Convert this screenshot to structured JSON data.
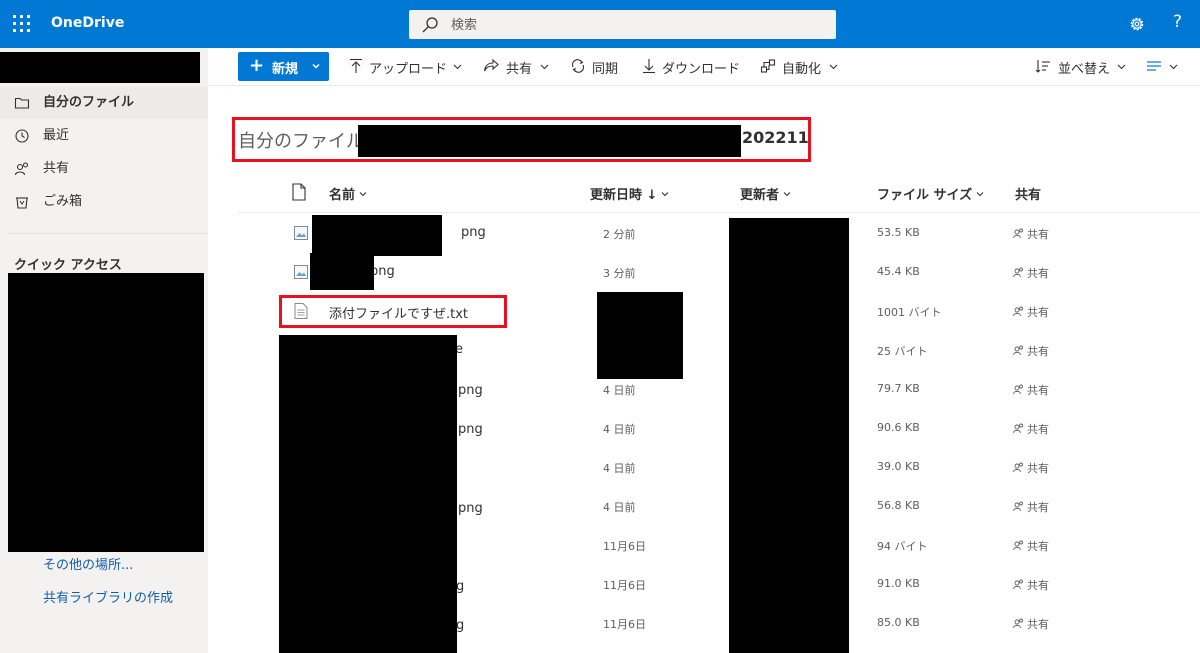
{
  "app": {
    "name": "OneDrive"
  },
  "search": {
    "placeholder": "検索"
  },
  "header": {
    "help_label": "?"
  },
  "nav": {
    "items": [
      {
        "label": "自分のファイル",
        "icon": "folder-icon"
      },
      {
        "label": "最近",
        "icon": "recent-icon"
      },
      {
        "label": "共有",
        "icon": "shared-icon"
      },
      {
        "label": "ごみ箱",
        "icon": "recycle-bin-icon"
      }
    ],
    "quick_access_title": "クイック アクセス",
    "links": [
      "その他の場所...",
      "共有ライブラリの作成"
    ]
  },
  "toolbar": {
    "new_label": "新規",
    "upload_label": "アップロード",
    "share_label": "共有",
    "sync_label": "同期",
    "download_label": "ダウンロード",
    "automate_label": "自動化",
    "sort_label": "並べ替え"
  },
  "breadcrumb": {
    "title": "自分のファイル",
    "suffix": "202211"
  },
  "table": {
    "headers": {
      "name": "名前",
      "modified": "更新日時 ↓",
      "modified_by": "更新者",
      "size": "ファイル サイズ",
      "sharing": "共有"
    },
    "rows": [
      {
        "name": "png",
        "modified": "2 分前",
        "size": "53.5 KB",
        "sharing": "共有",
        "type": "image"
      },
      {
        "name": "png",
        "modified": "3 分前",
        "size": "45.4 KB",
        "sharing": "共有",
        "type": "image"
      },
      {
        "name": "添付ファイルですぜ.txt",
        "modified": "",
        "size": "1001 バイト",
        "sharing": "共有",
        "type": "text"
      },
      {
        "name": "e",
        "modified": "",
        "size": "25 バイト",
        "sharing": "共有",
        "type": "text"
      },
      {
        "name": "png",
        "modified": "4 日前",
        "size": "79.7 KB",
        "sharing": "共有",
        "type": "image"
      },
      {
        "name": "png",
        "modified": "4 日前",
        "size": "90.6 KB",
        "sharing": "共有",
        "type": "image"
      },
      {
        "name": "",
        "modified": "4 日前",
        "size": "39.0 KB",
        "sharing": "共有",
        "type": "image"
      },
      {
        "name": "png",
        "modified": "4 日前",
        "size": "56.8 KB",
        "sharing": "共有",
        "type": "image"
      },
      {
        "name": "",
        "modified": "11月6日",
        "size": "94 バイト",
        "sharing": "共有",
        "type": "text"
      },
      {
        "name": "g",
        "modified": "11月6日",
        "size": "91.0 KB",
        "sharing": "共有",
        "type": "image"
      },
      {
        "name": "g",
        "modified": "11月6日",
        "size": "85.0 KB",
        "sharing": "共有",
        "type": "image"
      }
    ]
  },
  "colors": {
    "brand": "#0078d4",
    "highlight": "#e81123",
    "nav_bg": "#f3f2f1",
    "link": "#0f5eab"
  }
}
